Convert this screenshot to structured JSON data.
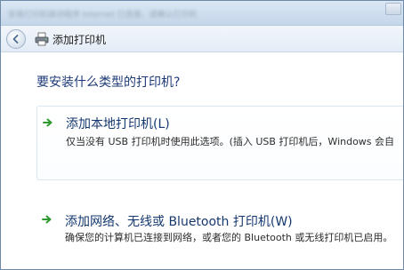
{
  "window": {
    "blurred_title": "安装打印机驱动程序 Internet 已连接，请确认打印机"
  },
  "nav": {
    "title": "添加打印机"
  },
  "main": {
    "heading": "要安装什么类型的打印机?",
    "options": [
      {
        "title": "添加本地打印机(L)",
        "description": "仅当没有 USB 打印机时使用此选项。(插入 USB 打印机后，Windows 会自"
      },
      {
        "title": "添加网络、无线或 Bluetooth 打印机(W)",
        "description": "确保您的计算机已连接到网络，或者您的 Bluetooth 或无线打印机已启用。"
      }
    ]
  },
  "icons": {
    "back": "back-arrow-icon",
    "printer": "printer-icon",
    "option_arrow": "green-arrow-icon"
  },
  "colors": {
    "heading": "#1e3a78",
    "option_title": "#14386e",
    "arrow": "#2e9a2e"
  }
}
